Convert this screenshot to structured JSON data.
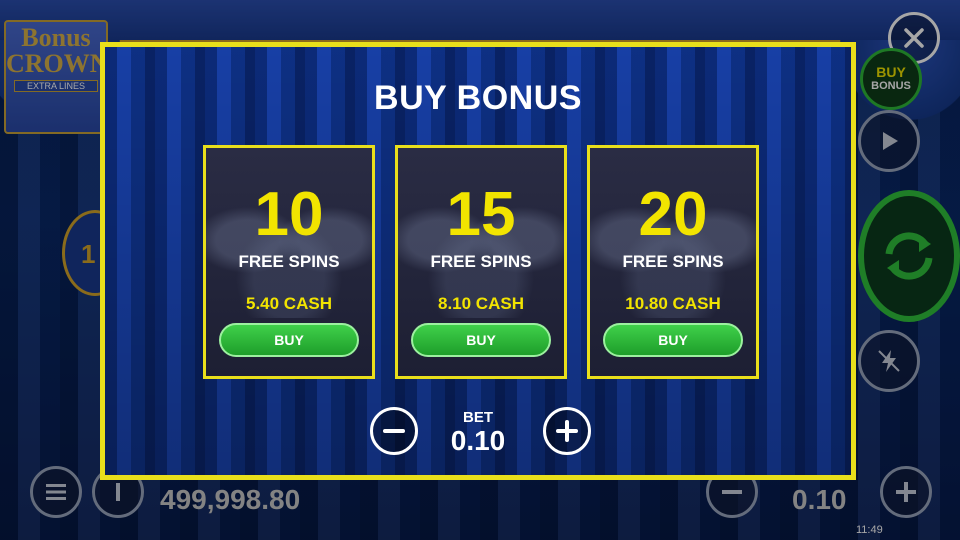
{
  "background": {
    "logo": {
      "line1": "Bonus",
      "line2": "CROWN",
      "line3": "EXTRA LINES"
    },
    "side_number": "1",
    "balance": "499,998.80",
    "bet": "0.10",
    "clock": "11:49"
  },
  "controls": {
    "buy_bonus_line1": "BUY",
    "buy_bonus_line2": "BONUS"
  },
  "popup": {
    "title": "BUY BONUS",
    "options": [
      {
        "spins": "10",
        "label": "FREE SPINS",
        "price": "5.40 CASH",
        "button": "BUY"
      },
      {
        "spins": "15",
        "label": "FREE SPINS",
        "price": "8.10 CASH",
        "button": "BUY"
      },
      {
        "spins": "20",
        "label": "FREE SPINS",
        "price": "10.80 CASH",
        "button": "BUY"
      }
    ],
    "bet_label": "BET",
    "bet_value": "0.10"
  },
  "icons": {
    "close": "close-icon",
    "minus": "minus-icon",
    "plus": "plus-icon",
    "menu": "menu-icon",
    "info": "info-icon",
    "play": "play-icon",
    "spin": "spin-icon",
    "turbo": "turbo-icon"
  },
  "colors": {
    "accent_yellow": "#f2e400",
    "frame_yellow": "#e9df1b",
    "buy_green": "#2fb83a",
    "curtain_blue": "#0d2f86"
  }
}
